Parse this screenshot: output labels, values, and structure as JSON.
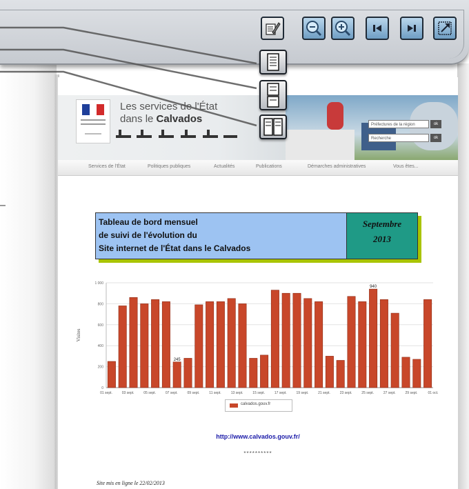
{
  "toolbar": {
    "buttons": [
      {
        "name": "edit-notes-button",
        "icon": "pencil-notes-icon"
      },
      {
        "name": "zoom-out-button",
        "icon": "zoom-out-icon"
      },
      {
        "name": "zoom-in-button",
        "icon": "zoom-in-icon"
      },
      {
        "name": "first-page-button",
        "icon": "skip-first-icon"
      },
      {
        "name": "last-page-button",
        "icon": "skip-last-icon"
      },
      {
        "name": "fullscreen-button",
        "icon": "expand-icon"
      }
    ],
    "view_modes": [
      "single-page-icon",
      "continuous-pages-icon",
      "two-page-icon"
    ]
  },
  "banner": {
    "line1": "Les services de l'État",
    "line2_a": "dans le ",
    "line2_b": "Calvados",
    "search_placeholder_1": "Préfectures de la région",
    "search_placeholder_2": "Recherche",
    "ok": "ok"
  },
  "nav": [
    "Services de l'État",
    "Politiques publiques",
    "Actualités",
    "Publications",
    "Démarches administratives",
    "Vous êtes..."
  ],
  "title": {
    "line1": "Tableau de bord mensuel",
    "line2": "de suivi de l'évolution du",
    "line3": "Site internet de l'État dans le Calvados",
    "month": "Septembre",
    "year": "2013"
  },
  "chart_data": {
    "type": "bar",
    "ylabel": "Visites",
    "ylim": [
      0,
      1000
    ],
    "yticks": [
      "1 000",
      "800",
      "600",
      "400",
      "200",
      "0"
    ],
    "xticks": [
      "01 sept.",
      "03 sept.",
      "05 sept.",
      "07 sept.",
      "09 sept.",
      "11 sept.",
      "13 sept.",
      "15 sept.",
      "17 sept.",
      "19 sept.",
      "21 sept.",
      "23 sept.",
      "25 sept.",
      "27 sept.",
      "29 sept.",
      "01 oct."
    ],
    "values": [
      250,
      780,
      860,
      800,
      840,
      820,
      245,
      280,
      790,
      820,
      820,
      850,
      800,
      280,
      310,
      930,
      900,
      900,
      850,
      820,
      300,
      260,
      870,
      820,
      940,
      840,
      710,
      290,
      270,
      840
    ],
    "labels": [
      {
        "index": 6,
        "text": "245"
      },
      {
        "index": 24,
        "text": "940"
      }
    ],
    "series": [
      {
        "name": "calvados.gouv.fr",
        "color": "#c8472a"
      }
    ],
    "grid": true,
    "legend": "bottom"
  },
  "link": "http://www.calvados.gouv.fr/",
  "stars": "**********",
  "footer": "Site mis en  ligne le 22/02/2013"
}
